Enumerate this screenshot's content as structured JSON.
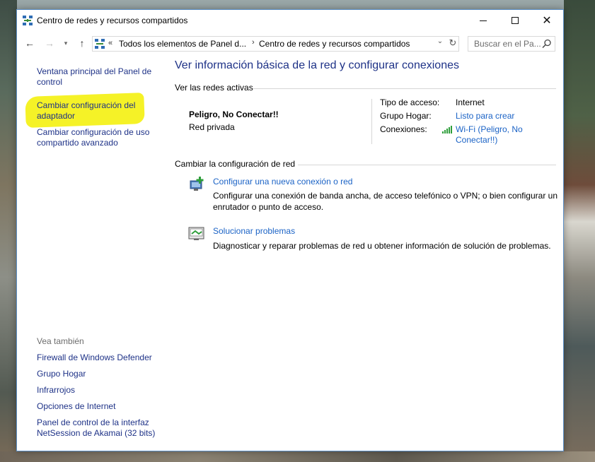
{
  "window": {
    "title": "Centro de redes y recursos compartidos"
  },
  "nav": {
    "address_segment_1": "Todos los elementos de Panel d...",
    "address_segment_2": "Centro de redes y recursos compartidos",
    "search_placeholder": "Buscar en el Pa..."
  },
  "sidebar": {
    "links": [
      "Ventana principal del Panel de control",
      "Cambiar configuración del adaptador",
      "Cambiar configuración de uso compartido avanzado"
    ],
    "see_also_label": "Vea también",
    "see_also": [
      "Firewall de Windows Defender",
      "Grupo Hogar",
      "Infrarrojos",
      "Opciones de Internet",
      "Panel de control de la interfaz NetSession de Akamai (32 bits)"
    ],
    "highlight_color": "#f5f227"
  },
  "main": {
    "title": "Ver información básica de la red y configurar conexiones",
    "active_networks_header": "Ver las redes activas",
    "network": {
      "name": "Peligro, No Conectar!!",
      "type": "Red privada",
      "access_type_label": "Tipo de acceso:",
      "access_type_value": "Internet",
      "homegroup_label": "Grupo Hogar:",
      "homegroup_value": "Listo para crear",
      "connections_label": "Conexiones:",
      "connections_value": "Wi-Fi (Peligro, No Conectar!!)"
    },
    "change_settings_header": "Cambiar la configuración de red",
    "tasks": [
      {
        "link": "Configurar una nueva conexión o red",
        "description": "Configurar una conexión de banda ancha, de acceso telefónico o VPN; o bien configurar un enrutador o punto de acceso.",
        "icon": "new-connection-icon"
      },
      {
        "link": "Solucionar problemas",
        "description": "Diagnosticar y reparar problemas de red u obtener información de solución de problemas.",
        "icon": "troubleshoot-icon"
      }
    ]
  },
  "colors": {
    "link": "#1e3287",
    "link_bright": "#1b63c6",
    "title": "#1e3287"
  }
}
